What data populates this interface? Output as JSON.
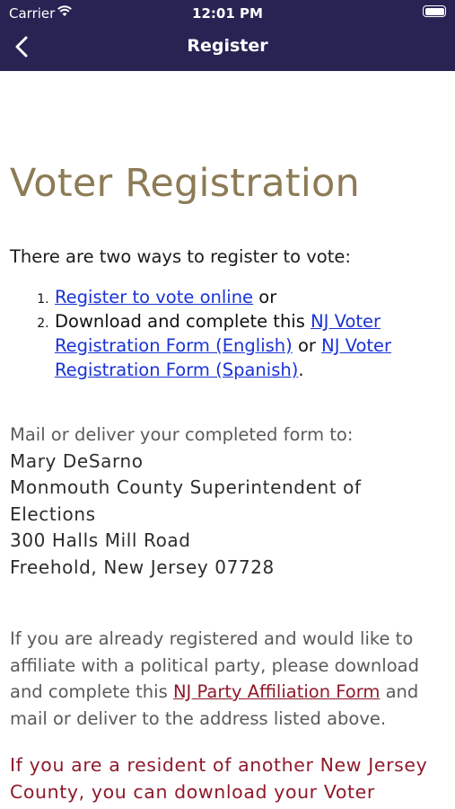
{
  "status_bar": {
    "carrier": "Carrier",
    "time": "12:01 PM"
  },
  "nav": {
    "title": "Register"
  },
  "page": {
    "heading": "Voter Registration",
    "intro": "There are two ways to register to vote:",
    "steps": {
      "s1_link": "Register to vote online",
      "s1_after": " or",
      "s2_before": "Download and complete this ",
      "s2_link_english": "NJ Voter Registration Form (English)",
      "s2_mid": " or ",
      "s2_link_spanish": "NJ Voter Registration Form (Spanish)",
      "s2_after": "."
    },
    "mail_intro": "Mail or deliver your completed form to:",
    "address": {
      "name": "Mary DeSarno",
      "title": "Monmouth County Superintendent of Elections",
      "street": "300 Halls Mill Road",
      "city": "Freehold, New Jersey 07728"
    },
    "affiliation": {
      "before": "If you are already registered and would like to affiliate with a political party, please download and complete this ",
      "link": "NJ Party Affiliation Form",
      "after": " and mail or deliver to the address listed above."
    },
    "resident_note": "If you are a resident of another New Jersey County, you can download your Voter"
  }
}
